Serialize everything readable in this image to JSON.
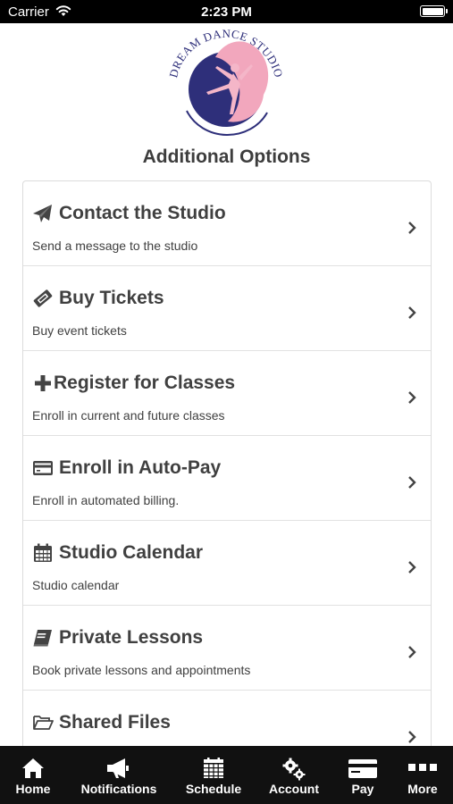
{
  "status_bar": {
    "carrier": "Carrier",
    "time": "2:23 PM"
  },
  "logo": {
    "text": "DREAM DANCE STUDIO"
  },
  "page": {
    "title": "Additional Options"
  },
  "options": [
    {
      "title": "Contact the Studio",
      "subtitle": "Send a message to the studio",
      "icon": "paper-plane-icon"
    },
    {
      "title": "Buy Tickets",
      "subtitle": "Buy event tickets",
      "icon": "ticket-icon"
    },
    {
      "title": "Register for Classes",
      "subtitle": "Enroll in current and future classes",
      "icon": "plus-icon"
    },
    {
      "title": "Enroll in Auto-Pay",
      "subtitle": "Enroll in automated billing.",
      "icon": "credit-card-icon"
    },
    {
      "title": "Studio Calendar",
      "subtitle": "Studio calendar",
      "icon": "calendar-icon"
    },
    {
      "title": "Private Lessons",
      "subtitle": "Book private lessons and appointments",
      "icon": "book-icon"
    },
    {
      "title": "Shared Files",
      "subtitle": "",
      "icon": "folder-open-icon"
    }
  ],
  "tabbar": {
    "tabs": [
      {
        "label": "Home",
        "icon": "home-icon"
      },
      {
        "label": "Notifications",
        "icon": "megaphone-icon"
      },
      {
        "label": "Schedule",
        "icon": "calendar-grid-icon"
      },
      {
        "label": "Account",
        "icon": "gears-icon"
      },
      {
        "label": "Pay",
        "icon": "credit-card-icon"
      },
      {
        "label": "More",
        "icon": "more-dots-icon"
      }
    ]
  },
  "colors": {
    "logo_navy": "#2e2f7a",
    "logo_pink": "#f2a7bd",
    "tabbar_bg": "#111111",
    "text": "#404040"
  }
}
